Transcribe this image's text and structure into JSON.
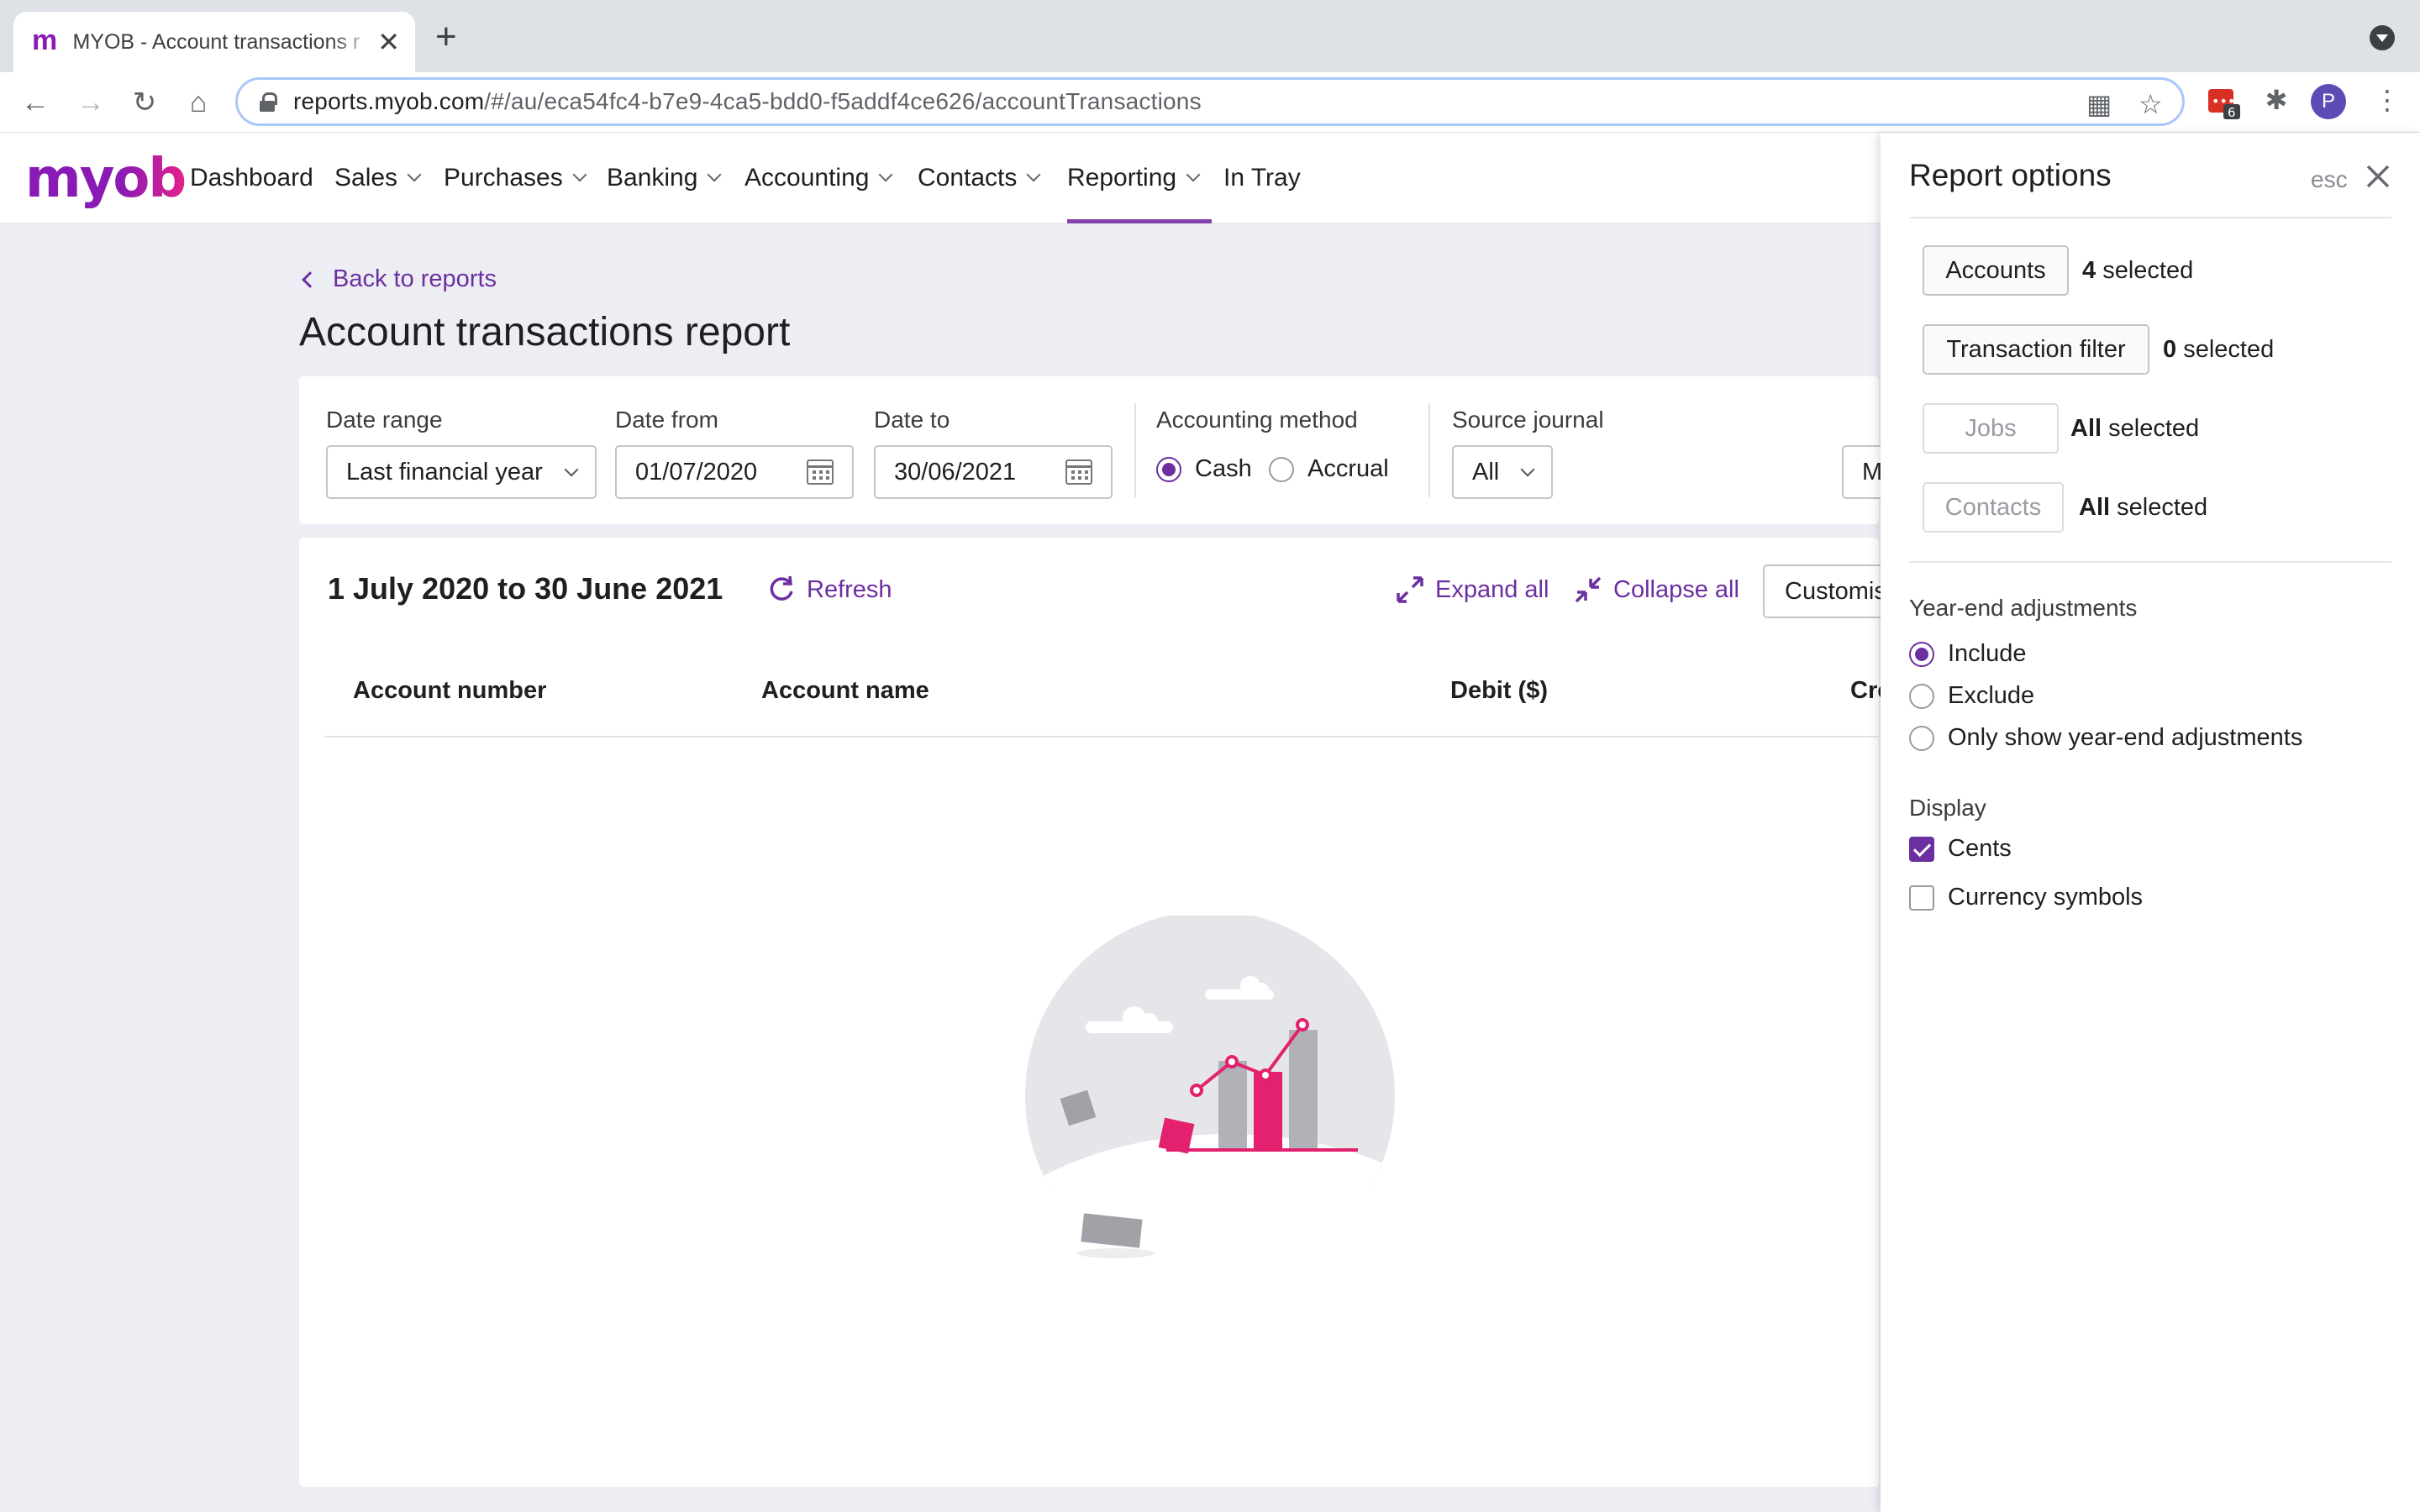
{
  "browser": {
    "tab_title": "MYOB - Account transactions r",
    "favicon": "m",
    "url_host": "reports.myob.com",
    "url_path": "/#/au/eca54fc4-b7e9-4ca5-bdd0-f5addf4ce626/accountTransactions",
    "extension_badge": "6",
    "profile_initial": "P"
  },
  "app": {
    "logo": "myob",
    "nav": [
      "Dashboard",
      "Sales",
      "Purchases",
      "Banking",
      "Accounting",
      "Contacts",
      "Reporting",
      "In Tray"
    ],
    "active_nav": "Reporting",
    "accent_color": "#6b2fa0"
  },
  "page": {
    "back_link": "Back to reports",
    "title": "Account transactions report"
  },
  "filters": {
    "date_range_label": "Date range",
    "date_range_value": "Last financial year",
    "date_from_label": "Date from",
    "date_from_value": "01/07/2020",
    "date_to_label": "Date to",
    "date_to_value": "30/06/2021",
    "accounting_method_label": "Accounting method",
    "accounting_methods": [
      "Cash",
      "Accrual"
    ],
    "accounting_method_selected": "Cash",
    "source_journal_label": "Source journal",
    "source_journal_value": "All",
    "partial_button": "M"
  },
  "results": {
    "period": "1 July 2020 to 30 June 2021",
    "refresh": "Refresh",
    "expand_all": "Expand all",
    "collapse_all": "Collapse all",
    "customise": "Customise",
    "columns": [
      "Account number",
      "Account name",
      "Debit ($)",
      "Credit ($)"
    ]
  },
  "drawer": {
    "title": "Report options",
    "esc": "esc",
    "options": [
      {
        "label": "Accounts",
        "count": "4",
        "suffix": "selected",
        "disabled": false
      },
      {
        "label": "Transaction filter",
        "count": "0",
        "suffix": "selected",
        "disabled": false
      },
      {
        "label": "Jobs",
        "count": "All",
        "suffix": "selected",
        "disabled": true
      },
      {
        "label": "Contacts",
        "count": "All",
        "suffix": "selected",
        "disabled": true
      }
    ],
    "year_end_label": "Year-end adjustments",
    "year_end_options": [
      "Include",
      "Exclude",
      "Only show year-end adjustments"
    ],
    "year_end_selected": "Include",
    "display_label": "Display",
    "display_options": [
      {
        "label": "Cents",
        "checked": true
      },
      {
        "label": "Currency symbols",
        "checked": false
      }
    ]
  }
}
